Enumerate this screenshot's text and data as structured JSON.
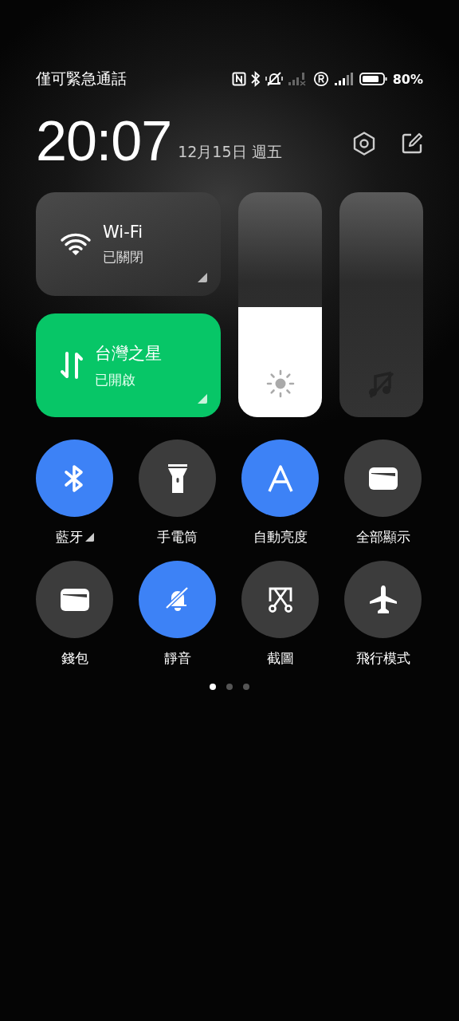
{
  "status_bar": {
    "carrier": "僅可緊急通話",
    "battery": "80%"
  },
  "header": {
    "time": "20:07",
    "date": "12月15日 週五"
  },
  "tiles": [
    {
      "kind": "wifi",
      "title": "Wi-Fi",
      "status": "已關閉",
      "on": false
    },
    {
      "kind": "data",
      "title": "台灣之星",
      "status": "已開啟",
      "on": true
    }
  ],
  "sliders": [
    {
      "kind": "brightness",
      "level": 0.49
    },
    {
      "kind": "volume"
    }
  ],
  "toggles": [
    {
      "kind": "bluetooth",
      "label": "藍牙",
      "on": true,
      "expandable": true
    },
    {
      "kind": "flashlight",
      "label": "手電筒",
      "on": false,
      "expandable": false
    },
    {
      "kind": "auto_brightness",
      "label": "自動亮度",
      "on": true,
      "expandable": false
    },
    {
      "kind": "card",
      "label": "全部顯示",
      "on": false,
      "expandable": false
    },
    {
      "kind": "card",
      "label": "錢包",
      "on": false,
      "expandable": false
    },
    {
      "kind": "mute",
      "label": "靜音",
      "on": true,
      "expandable": false
    },
    {
      "kind": "screenshot",
      "label": "截圖",
      "on": false,
      "expandable": false
    },
    {
      "kind": "airplane",
      "label": "飛行模式",
      "on": false,
      "expandable": false
    }
  ],
  "pages": [
    {
      "selected": true
    },
    {
      "selected": false
    },
    {
      "selected": false
    }
  ]
}
